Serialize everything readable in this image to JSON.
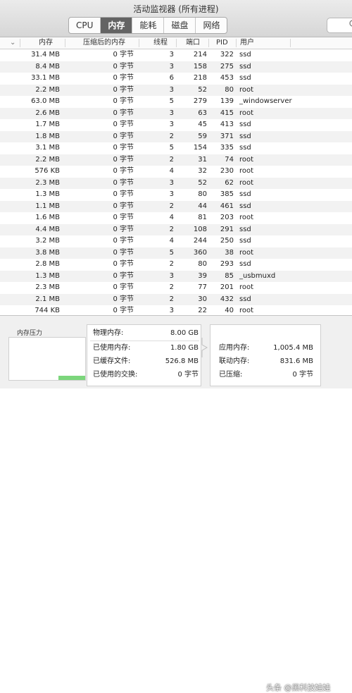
{
  "window": {
    "title": "活动监视器 (所有进程)"
  },
  "tabs": [
    {
      "label": "CPU",
      "active": false
    },
    {
      "label": "内存",
      "active": true
    },
    {
      "label": "能耗",
      "active": false
    },
    {
      "label": "磁盘",
      "active": false
    },
    {
      "label": "网络",
      "active": false
    }
  ],
  "columns": {
    "sort_indicator": "⌄",
    "memory": "内存",
    "compressed": "压缩后的内存",
    "threads": "线程",
    "ports": "端口",
    "pid": "PID",
    "user": "用户"
  },
  "rows": [
    {
      "mem": "31.4 MB",
      "comp": "0 字节",
      "threads": "3",
      "ports": "214",
      "pid": "322",
      "user": "ssd"
    },
    {
      "mem": "8.4 MB",
      "comp": "0 字节",
      "threads": "3",
      "ports": "158",
      "pid": "275",
      "user": "ssd"
    },
    {
      "mem": "33.1 MB",
      "comp": "0 字节",
      "threads": "6",
      "ports": "218",
      "pid": "453",
      "user": "ssd"
    },
    {
      "mem": "2.2 MB",
      "comp": "0 字节",
      "threads": "3",
      "ports": "52",
      "pid": "80",
      "user": "root"
    },
    {
      "mem": "63.0 MB",
      "comp": "0 字节",
      "threads": "5",
      "ports": "279",
      "pid": "139",
      "user": "_windowserver"
    },
    {
      "mem": "2.6 MB",
      "comp": "0 字节",
      "threads": "3",
      "ports": "63",
      "pid": "415",
      "user": "root"
    },
    {
      "mem": "1.7 MB",
      "comp": "0 字节",
      "threads": "3",
      "ports": "45",
      "pid": "413",
      "user": "ssd"
    },
    {
      "mem": "1.8 MB",
      "comp": "0 字节",
      "threads": "2",
      "ports": "59",
      "pid": "371",
      "user": "ssd"
    },
    {
      "mem": "3.1 MB",
      "comp": "0 字节",
      "threads": "5",
      "ports": "154",
      "pid": "335",
      "user": "ssd"
    },
    {
      "mem": "2.2 MB",
      "comp": "0 字节",
      "threads": "2",
      "ports": "31",
      "pid": "74",
      "user": "root"
    },
    {
      "mem": "576 KB",
      "comp": "0 字节",
      "threads": "4",
      "ports": "32",
      "pid": "230",
      "user": "root"
    },
    {
      "mem": "2.3 MB",
      "comp": "0 字节",
      "threads": "3",
      "ports": "52",
      "pid": "62",
      "user": "root"
    },
    {
      "mem": "1.3 MB",
      "comp": "0 字节",
      "threads": "3",
      "ports": "80",
      "pid": "385",
      "user": "ssd"
    },
    {
      "mem": "1.1 MB",
      "comp": "0 字节",
      "threads": "2",
      "ports": "44",
      "pid": "461",
      "user": "ssd"
    },
    {
      "mem": "1.6 MB",
      "comp": "0 字节",
      "threads": "4",
      "ports": "81",
      "pid": "203",
      "user": "root"
    },
    {
      "mem": "4.4 MB",
      "comp": "0 字节",
      "threads": "2",
      "ports": "108",
      "pid": "291",
      "user": "ssd"
    },
    {
      "mem": "3.2 MB",
      "comp": "0 字节",
      "threads": "4",
      "ports": "244",
      "pid": "250",
      "user": "ssd"
    },
    {
      "mem": "3.8 MB",
      "comp": "0 字节",
      "threads": "5",
      "ports": "360",
      "pid": "38",
      "user": "root"
    },
    {
      "mem": "2.8 MB",
      "comp": "0 字节",
      "threads": "2",
      "ports": "80",
      "pid": "293",
      "user": "ssd"
    },
    {
      "mem": "1.3 MB",
      "comp": "0 字节",
      "threads": "3",
      "ports": "39",
      "pid": "85",
      "user": "_usbmuxd"
    },
    {
      "mem": "2.3 MB",
      "comp": "0 字节",
      "threads": "2",
      "ports": "77",
      "pid": "201",
      "user": "root"
    },
    {
      "mem": "2.1 MB",
      "comp": "0 字节",
      "threads": "2",
      "ports": "30",
      "pid": "432",
      "user": "ssd"
    },
    {
      "mem": "744 KB",
      "comp": "0 字节",
      "threads": "3",
      "ports": "22",
      "pid": "40",
      "user": "root"
    }
  ],
  "memory_pressure": {
    "label": "内存压力",
    "level_fraction": 0.1,
    "color": "#7cd67c"
  },
  "memory_summary": {
    "physical": {
      "label": "物理内存:",
      "value": "8.00 GB"
    },
    "used": {
      "label": "已使用内存:",
      "value": "1.80 GB"
    },
    "cached": {
      "label": "已缓存文件:",
      "value": "526.8 MB"
    },
    "swap": {
      "label": "已使用的交换:",
      "value": "0 字节"
    }
  },
  "memory_breakdown": {
    "app": {
      "label": "应用内存:",
      "value": "1,005.4 MB"
    },
    "wired": {
      "label": "联动内存:",
      "value": "831.6 MB"
    },
    "compressed": {
      "label": "已压缩:",
      "value": "0 字节"
    }
  },
  "watermark": "头条 @黑科技娃娃",
  "colors": {
    "active_tab": "#636363",
    "stripe": "#f2f2f2"
  }
}
